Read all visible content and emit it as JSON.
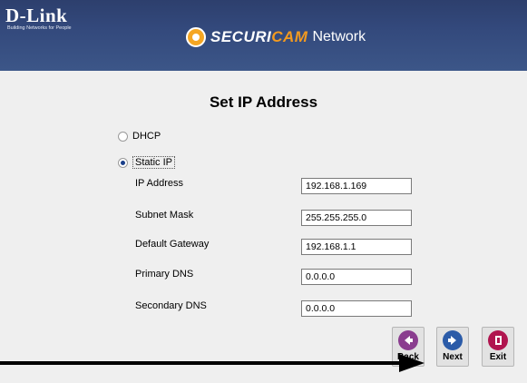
{
  "header": {
    "brand_name": "D-Link",
    "brand_tagline": "Building Networks for People",
    "product_brand": "SECURI",
    "product_brand_accent": "CAM",
    "product_suffix": "Network"
  },
  "title": "Set IP Address",
  "mode": {
    "options": [
      {
        "label": "DHCP",
        "selected": false
      },
      {
        "label": "Static IP",
        "selected": true
      }
    ]
  },
  "fields": [
    {
      "label": "IP Address",
      "value": "192.168.1.169"
    },
    {
      "label": "Subnet Mask",
      "value": "255.255.255.0"
    },
    {
      "label": "Default Gateway",
      "value": "192.168.1.1"
    },
    {
      "label": "Primary DNS",
      "value": "0.0.0.0"
    },
    {
      "label": "Secondary DNS",
      "value": "0.0.0.0"
    }
  ],
  "nav": {
    "back_label": "Back",
    "next_label": "Next",
    "exit_label": "Exit"
  },
  "colors": {
    "header_bg": "#33497c",
    "accent_orange": "#f39a1f",
    "content_bg": "#efefef",
    "back_icon": "#8a3d8f",
    "next_icon": "#2b5ba8",
    "exit_icon": "#b0154f"
  },
  "icons": {
    "back": "arrow-left-icon",
    "next": "arrow-right-icon",
    "exit": "exit-door-icon",
    "product": "camera-lens-icon"
  }
}
